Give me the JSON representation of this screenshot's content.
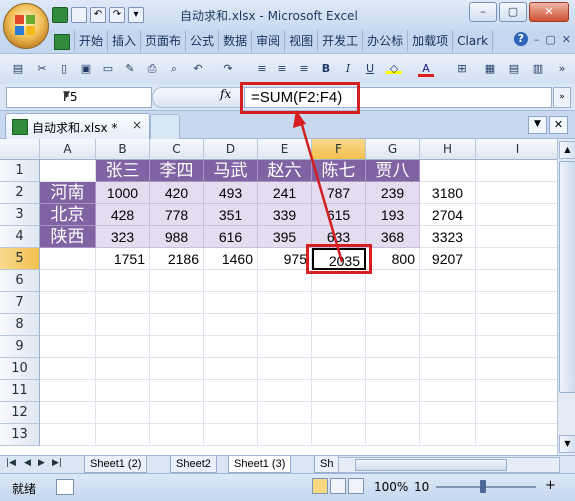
{
  "window": {
    "title": "自动求和.xlsx - Microsoft Excel",
    "minimize": "–",
    "restore": "▢",
    "close": "✕"
  },
  "ribbon": {
    "tabs": [
      "开始",
      "插入",
      "页面布",
      "公式",
      "数据",
      "审阅",
      "视图",
      "开发工",
      "办公标",
      "加载项"
    ],
    "user": "Clark",
    "help": "?",
    "mini_minimize": "–",
    "mini_restore": "▢",
    "mini_close": "✕"
  },
  "toolbar": {
    "bold": "B",
    "italic": "I",
    "underline": "U",
    "font_color_letter": "A"
  },
  "formula_bar": {
    "name_box": "F5",
    "fx": "fx",
    "formula": "=SUM(F2:F4)"
  },
  "doc_tab": {
    "label": "自动求和.xlsx *",
    "close": "×"
  },
  "grid": {
    "columns": [
      "A",
      "B",
      "C",
      "D",
      "E",
      "F",
      "G",
      "H",
      "I"
    ],
    "rows": [
      "1",
      "2",
      "3",
      "4",
      "5",
      "6",
      "7",
      "8",
      "9",
      "10",
      "11",
      "12",
      "13"
    ],
    "header_names": [
      "张三",
      "李四",
      "马武",
      "赵六",
      "陈七",
      "贾八"
    ],
    "row_labels": [
      "河南",
      "北京",
      "陕西"
    ],
    "data": [
      [
        "1000",
        "420",
        "493",
        "241",
        "787",
        "239"
      ],
      [
        "428",
        "778",
        "351",
        "339",
        "615",
        "193"
      ],
      [
        "323",
        "988",
        "616",
        "395",
        "633",
        "368"
      ]
    ],
    "row_totals": [
      "3180",
      "2704",
      "3323"
    ],
    "col_totals": [
      "1751",
      "2186",
      "1460",
      "975",
      "2035",
      "800"
    ],
    "grand_total": "9207"
  },
  "sheets": {
    "tabs": [
      "Sheet1 (2)",
      "Sheet2",
      "Sheet1 (3)",
      "Sh"
    ],
    "active_index": 2
  },
  "status": {
    "ready": "就绪",
    "zoom": "100%",
    "zoom_short": "10",
    "minus": "–",
    "plus": "+"
  },
  "colors": {
    "header_purple": "#7f63a2",
    "data_lavender": "#e5dcef",
    "callout_red": "#d31f1f"
  }
}
